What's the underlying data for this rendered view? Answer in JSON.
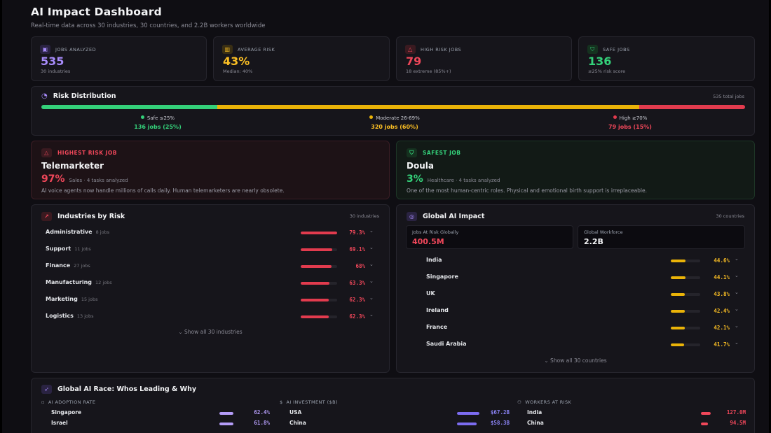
{
  "header": {
    "title": "AI Impact Dashboard",
    "subtitle": "Real-time data across 30 industries, 30 countries, and 2.2B workers worldwide"
  },
  "stats": [
    {
      "label": "JOBS ANALYZED",
      "value": "535",
      "sub": "30 industries",
      "icon": "briefcase-icon",
      "color": "#a78bfa"
    },
    {
      "label": "AVERAGE RISK",
      "value": "43%",
      "sub": "Median: 40%",
      "icon": "bar-chart-icon",
      "color": "#fbbf24"
    },
    {
      "label": "HIGH RISK JOBS",
      "value": "79",
      "sub": "18 extreme (85%+)",
      "icon": "warning-icon",
      "color": "#f0475a"
    },
    {
      "label": "SAFE JOBS",
      "value": "136",
      "sub": "≤25% risk score",
      "icon": "shield-icon",
      "color": "#34d17a"
    }
  ],
  "distribution": {
    "title": "Risk Distribution",
    "total": "535 total jobs",
    "segments": [
      {
        "label": "Safe ≤25%",
        "count": "136 jobs (25%)",
        "fraction": 0.25,
        "color": "#34d17a"
      },
      {
        "label": "Moderate 26-69%",
        "count": "320 jobs (60%)",
        "fraction": 0.6,
        "color": "#eab308"
      },
      {
        "label": "High ≥70%",
        "count": "79 jobs (15%)",
        "fraction": 0.15,
        "color": "#e23b4e"
      }
    ]
  },
  "highest": {
    "tag": "HIGHEST RISK JOB",
    "name": "Telemarketer",
    "pct": "97%",
    "meta": "Sales · 4 tasks analyzed",
    "desc": "AI voice agents now handle millions of calls daily. Human telemarketers are nearly obsolete."
  },
  "safest": {
    "tag": "SAFEST JOB",
    "name": "Doula",
    "pct": "3%",
    "meta": "Healthcare · 4 tasks analyzed",
    "desc": "One of the most human-centric roles. Physical and emotional birth support is irreplaceable."
  },
  "industries": {
    "title": "Industries by Risk",
    "meta": "30 industries",
    "show_all": "⌄  Show all 30 industries",
    "items": [
      {
        "name": "Administrative",
        "jobs": "8 jobs",
        "pct": "79.3%",
        "value": 79.3
      },
      {
        "name": "Support",
        "jobs": "11 jobs",
        "pct": "69.1%",
        "value": 69.1
      },
      {
        "name": "Finance",
        "jobs": "27 jobs",
        "pct": "68%",
        "value": 68
      },
      {
        "name": "Manufacturing",
        "jobs": "12 jobs",
        "pct": "63.3%",
        "value": 63.3
      },
      {
        "name": "Marketing",
        "jobs": "15 jobs",
        "pct": "62.3%",
        "value": 62.3
      },
      {
        "name": "Logistics",
        "jobs": "13 jobs",
        "pct": "62.3%",
        "value": 62.3
      }
    ]
  },
  "global": {
    "title": "Global AI Impact",
    "meta": "30 countries",
    "at_risk_label": "Jobs At Risk Globally",
    "at_risk_value": "400.5M",
    "workforce_label": "Global Workforce",
    "workforce_value": "2.2B",
    "show_all": "⌄  Show all 30 countries",
    "countries": [
      {
        "name": "India",
        "pct": "44.6%",
        "value": 44.6
      },
      {
        "name": "Singapore",
        "pct": "44.1%",
        "value": 44.1
      },
      {
        "name": "UK",
        "pct": "43.8%",
        "value": 43.8
      },
      {
        "name": "Ireland",
        "pct": "42.4%",
        "value": 42.4
      },
      {
        "name": "France",
        "pct": "42.1%",
        "value": 42.1
      },
      {
        "name": "Saudi Arabia",
        "pct": "41.7%",
        "value": 41.7
      }
    ]
  },
  "race": {
    "title": "Global AI Race: Whos Leading & Why",
    "adoption": {
      "label": "AI ADOPTION RATE",
      "rows": [
        {
          "name": "Singapore",
          "val": "62.4%",
          "value": 62.4
        },
        {
          "name": "Israel",
          "val": "61.8%",
          "value": 61.8
        }
      ]
    },
    "investment": {
      "label": "AI INVESTMENT ($B)",
      "rows": [
        {
          "name": "USA",
          "val": "$67.2B",
          "value": 67.2
        },
        {
          "name": "China",
          "val": "$58.3B",
          "value": 58.3
        }
      ]
    },
    "workers": {
      "label": "WORKERS AT RISK",
      "rows": [
        {
          "name": "India",
          "val": "127.0M",
          "value": 127.0
        },
        {
          "name": "China",
          "val": "94.5M",
          "value": 94.5
        }
      ]
    }
  }
}
